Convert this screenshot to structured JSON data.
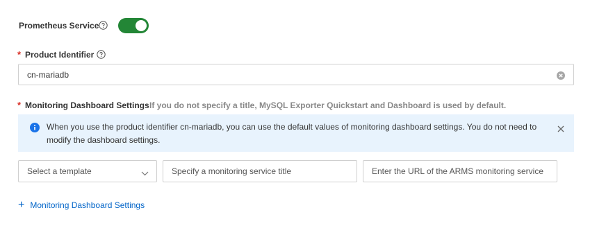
{
  "prometheus": {
    "label": "Prometheus Service",
    "enabled": true,
    "accent_color": "#238636"
  },
  "product_identifier": {
    "required_mark": "*",
    "label": "Product Identifier",
    "value": "cn-mariadb"
  },
  "dashboard_settings": {
    "required_mark": "*",
    "label": "Monitoring Dashboard Settings",
    "hint": "If you do not specify a title, MySQL Exporter Quickstart and Dashboard is used by default.",
    "alert": {
      "text": "When you use the product identifier cn-mariadb, you can use the default values of monitoring dashboard settings. You do not need to modify the dashboard settings.",
      "icon": "info-icon",
      "background_color": "#e8f3fd"
    },
    "template_select": {
      "placeholder": "Select a template"
    },
    "title_input": {
      "placeholder": "Specify a monitoring service title"
    },
    "url_input": {
      "placeholder": "Enter the URL of the ARMS monitoring service"
    },
    "add_link": {
      "plus": "+",
      "label": "Monitoring Dashboard Settings",
      "color": "#0064c8"
    }
  }
}
